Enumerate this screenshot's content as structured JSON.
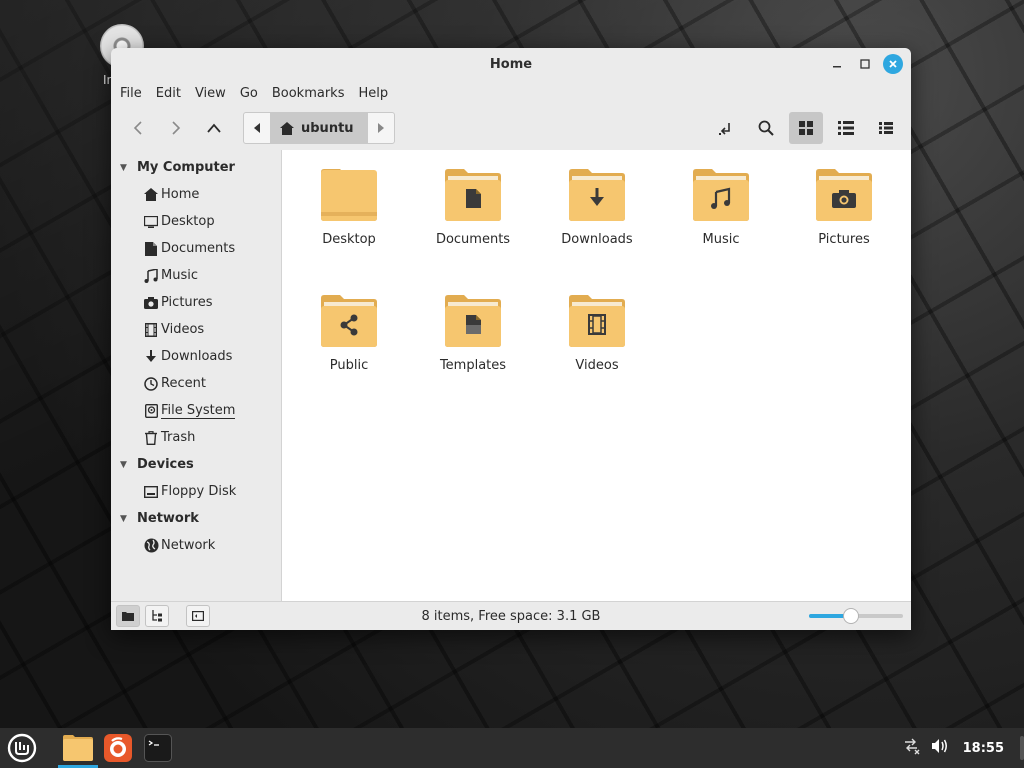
{
  "desktop": {
    "icon_label": "In"
  },
  "window": {
    "title": "Home"
  },
  "menu": [
    "File",
    "Edit",
    "View",
    "Go",
    "Bookmarks",
    "Help"
  ],
  "pathbar": {
    "current": "ubuntu"
  },
  "sidebar": {
    "sections": [
      {
        "header": "My Computer",
        "items": [
          {
            "label": "Home",
            "icon": "home-icon"
          },
          {
            "label": "Desktop",
            "icon": "desktop-icon"
          },
          {
            "label": "Documents",
            "icon": "document-icon"
          },
          {
            "label": "Music",
            "icon": "music-icon"
          },
          {
            "label": "Pictures",
            "icon": "camera-icon"
          },
          {
            "label": "Videos",
            "icon": "film-icon"
          },
          {
            "label": "Downloads",
            "icon": "download-icon"
          },
          {
            "label": "Recent",
            "icon": "clock-icon"
          },
          {
            "label": "File System",
            "icon": "drive-icon"
          },
          {
            "label": "Trash",
            "icon": "trash-icon"
          }
        ]
      },
      {
        "header": "Devices",
        "items": [
          {
            "label": "Floppy Disk",
            "icon": "floppy-icon"
          }
        ]
      },
      {
        "header": "Network",
        "items": [
          {
            "label": "Network",
            "icon": "globe-icon"
          }
        ]
      }
    ]
  },
  "folders": [
    {
      "name": "Desktop",
      "emblem": "none"
    },
    {
      "name": "Documents",
      "emblem": "document"
    },
    {
      "name": "Downloads",
      "emblem": "download"
    },
    {
      "name": "Music",
      "emblem": "music"
    },
    {
      "name": "Pictures",
      "emblem": "camera"
    },
    {
      "name": "Public",
      "emblem": "share"
    },
    {
      "name": "Templates",
      "emblem": "template"
    },
    {
      "name": "Videos",
      "emblem": "film"
    }
  ],
  "status": {
    "text": "8 items, Free space: 3.1 GB",
    "zoom_fraction": 0.45
  },
  "taskbar": {
    "clock": "18:55"
  },
  "colors": {
    "accent": "#2ea7e0",
    "folder": "#f6c66f",
    "folder_dark": "#e2ac50"
  }
}
